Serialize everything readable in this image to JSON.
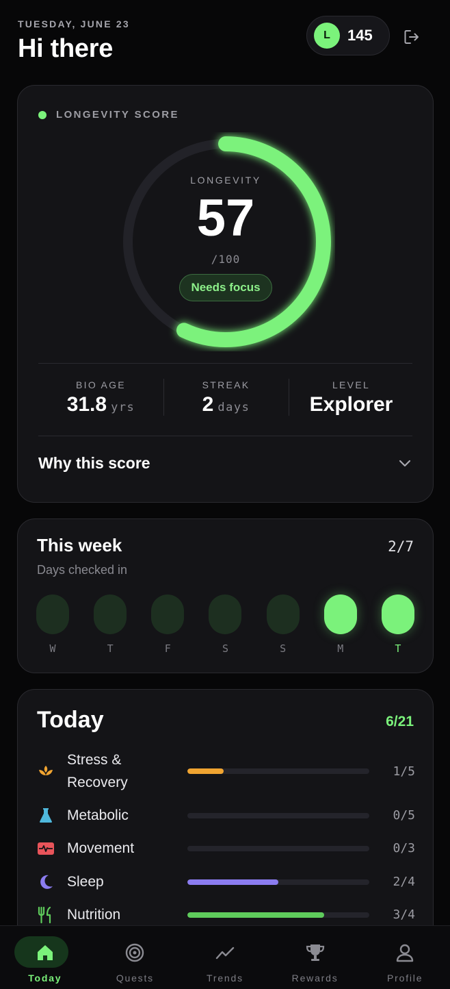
{
  "header": {
    "date": "TUESDAY, JUNE 23",
    "greeting": "Hi there",
    "avatar_initial": "L",
    "points": "145",
    "logout_icon": "logout-icon"
  },
  "score": {
    "section_label": "LONGEVITY SCORE",
    "ring_caption": "LONGEVITY",
    "value": "57",
    "max": "/100",
    "progress": 0.57,
    "badge": "Needs focus",
    "stats": [
      {
        "label": "BIO AGE",
        "value": "31.8",
        "unit": "yrs"
      },
      {
        "label": "STREAK",
        "value": "2",
        "unit": "days"
      },
      {
        "label": "LEVEL",
        "value": "Explorer",
        "unit": ""
      }
    ],
    "why_label": "Why this score"
  },
  "week": {
    "title": "This week",
    "count": "2/7",
    "subtitle": "Days checked in",
    "days": [
      {
        "label": "W",
        "checked": false
      },
      {
        "label": "T",
        "checked": false
      },
      {
        "label": "F",
        "checked": false
      },
      {
        "label": "S",
        "checked": false
      },
      {
        "label": "S",
        "checked": false
      },
      {
        "label": "M",
        "checked": true
      },
      {
        "label": "T",
        "checked": true
      }
    ]
  },
  "today": {
    "title": "Today",
    "count": "6/21",
    "categories": [
      {
        "name": "Stress & Recovery",
        "icon": "lotus-icon",
        "color": "#f0a431",
        "progress": 0.2,
        "count": "1/5"
      },
      {
        "name": "Metabolic",
        "icon": "flask-icon",
        "color": "#4fb8dc",
        "progress": 0,
        "count": "0/5"
      },
      {
        "name": "Movement",
        "icon": "heart-pulse-icon",
        "color": "#e8545a",
        "progress": 0,
        "count": "0/3"
      },
      {
        "name": "Sleep",
        "icon": "moon-icon",
        "color": "#8b7cf0",
        "progress": 0.5,
        "count": "2/4"
      },
      {
        "name": "Nutrition",
        "icon": "fork-knife-icon",
        "color": "#5fcc5c",
        "progress": 0.75,
        "count": "3/4"
      }
    ]
  },
  "nav": {
    "items": [
      {
        "label": "Today",
        "icon": "home-icon",
        "active": true
      },
      {
        "label": "Quests",
        "icon": "target-icon",
        "active": false
      },
      {
        "label": "Trends",
        "icon": "trend-icon",
        "active": false
      },
      {
        "label": "Rewards",
        "icon": "trophy-icon",
        "active": false
      },
      {
        "label": "Profile",
        "icon": "user-icon",
        "active": false
      }
    ]
  },
  "colors": {
    "accent": "#7bf27b",
    "background": "#070708",
    "card": "#141417"
  }
}
